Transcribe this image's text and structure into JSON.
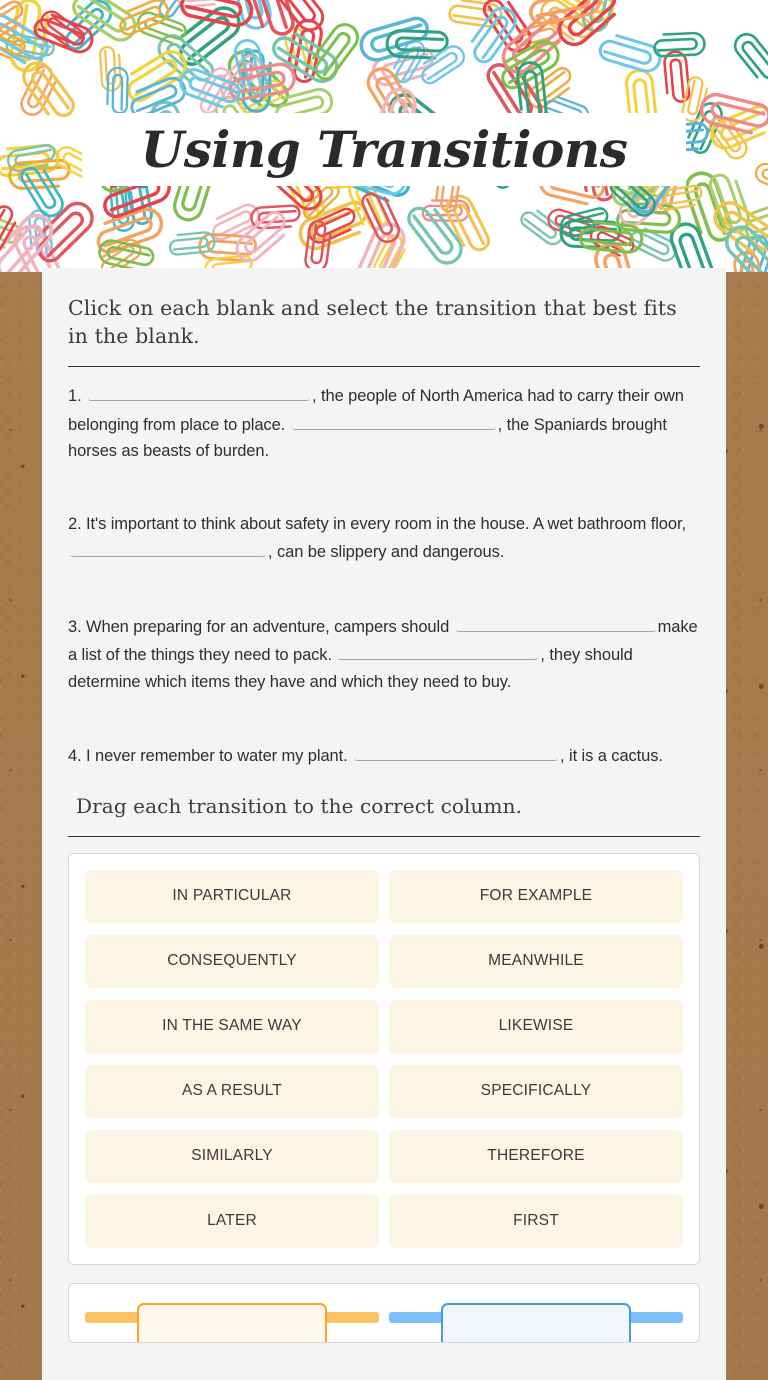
{
  "header": {
    "title": "Using Transitions",
    "pattern_icon": "paperclip-pattern"
  },
  "instructions": {
    "fill_in": "Click on each blank and select the transition that best fits in the blank.",
    "drag": "Drag each transition to the correct column."
  },
  "questions": [
    {
      "number": "1.",
      "segments": [
        {
          "type": "blank",
          "width": "b-w1"
        },
        {
          "type": "text",
          "value": ", the people of North America had to carry their own belonging from place to place."
        },
        {
          "type": "blank",
          "width": "b-w2"
        },
        {
          "type": "text",
          "value": ", the Spaniards brought horses as beasts of burden."
        }
      ]
    },
    {
      "number": "2.",
      "segments": [
        {
          "type": "text",
          "value": "It's important to think about safety in every room in the house. A wet bathroom floor,"
        },
        {
          "type": "blank",
          "width": "b-w3"
        },
        {
          "type": "text",
          "value": ", can be slippery and dangerous."
        }
      ]
    },
    {
      "number": "3.",
      "segments": [
        {
          "type": "text",
          "value": "When preparing for an adventure, campers should"
        },
        {
          "type": "blank",
          "width": "b-w4"
        },
        {
          "type": "text",
          "value": "make a list of the things they need to pack."
        },
        {
          "type": "blank",
          "width": "b-w5"
        },
        {
          "type": "text",
          "value": ", they should determine which items they have and which they need to buy."
        }
      ]
    },
    {
      "number": "4.",
      "segments": [
        {
          "type": "text",
          "value": "I never remember to water my plant."
        },
        {
          "type": "blank",
          "width": "b-w6"
        },
        {
          "type": "text",
          "value": ", it is a cactus."
        }
      ]
    }
  ],
  "transition_tiles": [
    "IN PARTICULAR",
    "FOR EXAMPLE",
    "CONSEQUENTLY",
    "MEANWHILE",
    "IN THE SAME WAY",
    "LIKEWISE",
    "AS A RESULT",
    "SPECIFICALLY",
    "SIMILARLY",
    "THEREFORE",
    "LATER",
    "FIRST"
  ],
  "dropzones": [
    {
      "accent": "#f5a623",
      "style": "orange"
    },
    {
      "accent": "#3f9cf0",
      "style": "blue"
    }
  ],
  "colors": {
    "page_background": "#a97c4e",
    "card_background": "#f4f4f4",
    "tile_background": "#fdf5e3",
    "blank_underline": "#8fa9ba",
    "title_text": "#2b2b2b"
  }
}
